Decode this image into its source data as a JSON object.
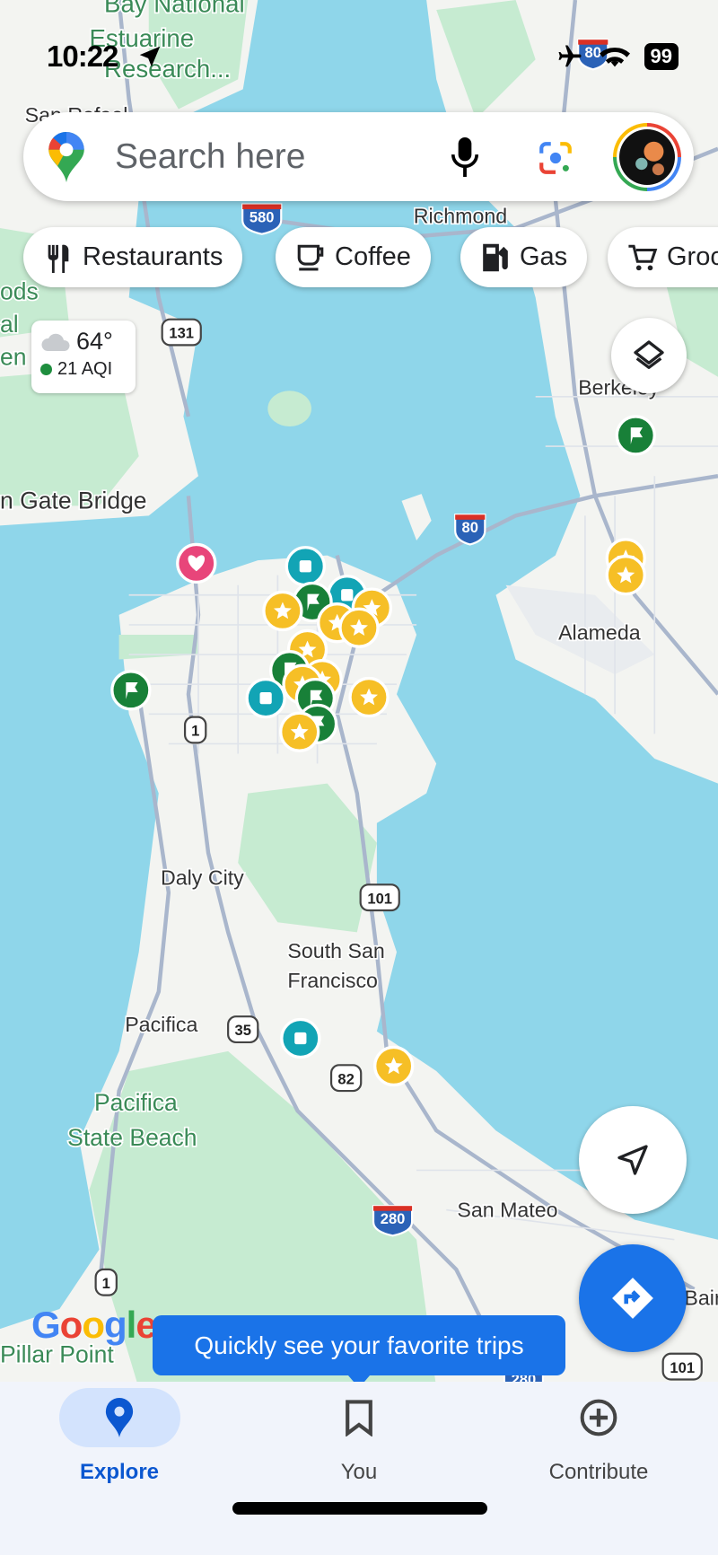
{
  "status_bar": {
    "time": "10:22",
    "battery": "99",
    "icons": [
      "location-arrow-icon",
      "airplane-icon",
      "wifi-icon",
      "battery-icon"
    ]
  },
  "search": {
    "placeholder": "Search here",
    "icons": [
      "google-maps-pin-icon",
      "microphone-icon",
      "google-lens-icon",
      "avatar"
    ]
  },
  "chips": [
    {
      "label": "Restaurants",
      "icon": "fork-knife-icon"
    },
    {
      "label": "Coffee",
      "icon": "coffee-cup-icon"
    },
    {
      "label": "Gas",
      "icon": "gas-pump-icon"
    },
    {
      "label": "Groceries",
      "visible_label": "Gro",
      "icon": "cart-icon"
    }
  ],
  "weather": {
    "temp": "64°",
    "aqi": "21 AQI",
    "aqi_color": "#1e8e3e",
    "icon": "cloud-icon"
  },
  "map": {
    "labels": [
      "Bay National",
      "Estuarine",
      "Research...",
      "San Rafael",
      "Richmond",
      "Berkeley",
      "n Gate Bridge",
      "Alameda",
      "Daly City",
      "South San",
      "Francisco",
      "Pacifica",
      "Pacifica",
      "State Beach",
      "San Mateo",
      "Pillar Point",
      "ods",
      "al",
      "en",
      "Bair"
    ],
    "shields": [
      "580",
      "131",
      "80",
      "1",
      "101",
      "35",
      "82",
      "280",
      "1",
      "101",
      "80",
      "280"
    ],
    "water_color": "#8fd6ea",
    "land_color": "#f3f4f1",
    "park_color": "#c6ebd1",
    "marker_types": {
      "star": "#f6bf26",
      "flag": "#188038",
      "square": "#12a4b5",
      "heart": "#e8457a"
    },
    "attribution": "Google"
  },
  "tooltip": {
    "text": "Quickly see your favorite trips"
  },
  "buttons": {
    "layers": "layers-icon",
    "my_location": "navigation-arrow-icon",
    "directions": "directions-icon"
  },
  "nav": [
    {
      "label": "Explore",
      "active": true
    },
    {
      "label": "You",
      "active": false
    },
    {
      "label": "Contribute",
      "active": false
    }
  ],
  "colors": {
    "accent": "#1a73e8",
    "nav_active_bg": "#d3e3fd",
    "nav_active_text": "#0b57d0"
  }
}
